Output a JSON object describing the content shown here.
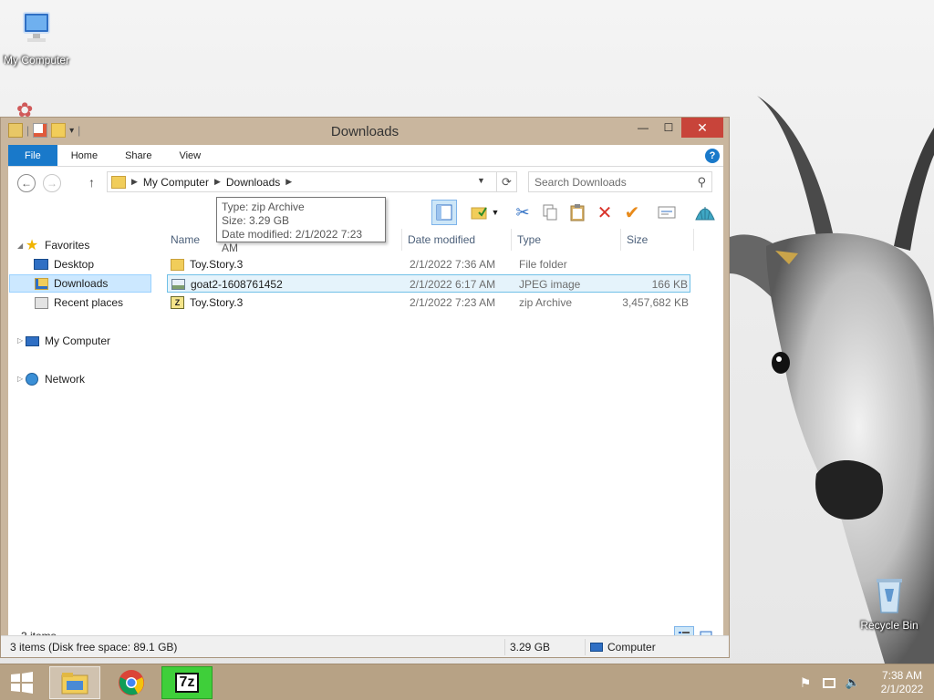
{
  "desktop": {
    "icons": [
      {
        "label": "My Computer"
      },
      {
        "label": "Recycle Bin"
      }
    ]
  },
  "window": {
    "title": "Downloads",
    "controls": {
      "minimize": "—",
      "maximize": "☐",
      "close": "✕"
    }
  },
  "ribbon": {
    "tabs": [
      {
        "label": "File"
      },
      {
        "label": "Home"
      },
      {
        "label": "Share"
      },
      {
        "label": "View"
      }
    ],
    "help": "?"
  },
  "address": {
    "crumbs": [
      "My Computer",
      "Downloads"
    ],
    "search_placeholder": "Search Downloads"
  },
  "nav": {
    "favorites": "Favorites",
    "desktop": "Desktop",
    "downloads": "Downloads",
    "recent": "Recent places",
    "computer": "My Computer",
    "network": "Network"
  },
  "columns": {
    "name": "Name",
    "date": "Date modified",
    "type": "Type",
    "size": "Size"
  },
  "files": [
    {
      "name": "Toy.Story.3",
      "date": "2/1/2022 7:36 AM",
      "type": "File folder",
      "size": "",
      "icon": "folder-icon"
    },
    {
      "name": "goat2-1608761452",
      "date": "2/1/2022 6:17 AM",
      "type": "JPEG image",
      "size": "166 KB",
      "icon": "image-file-icon"
    },
    {
      "name": "Toy.Story.3",
      "date": "2/1/2022 7:23 AM",
      "type": "zip Archive",
      "size": "3,457,682 KB",
      "icon": "zip-archive-icon"
    }
  ],
  "tooltip": {
    "type": "Type: zip Archive",
    "size": "Size: 3.29 GB",
    "date": "Date modified: 2/1/2022 7:23 AM"
  },
  "item_count": "3 items",
  "status": {
    "left": "3 items (Disk free space: 89.1 GB)",
    "size": "3.29 GB",
    "location": "Computer"
  },
  "clock": {
    "time": "7:38 AM",
    "date": "2/1/2022"
  },
  "colors": {
    "accent": "#1979ca",
    "close_button": "#c8443a",
    "window_frame": "#c9b69e",
    "taskbar": "#b7a285",
    "selection": "#e5f3fb"
  }
}
